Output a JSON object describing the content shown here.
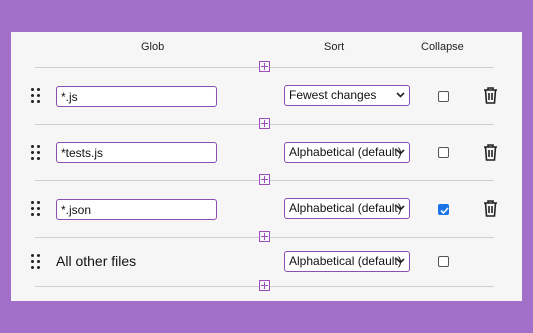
{
  "headers": {
    "glob": "Glob",
    "sort": "Sort",
    "collapse": "Collapse"
  },
  "rows": [
    {
      "glob": "*.js",
      "sort": "Fewest changes",
      "collapse": false
    },
    {
      "glob": "*tests.js",
      "sort": "Alphabetical (default)",
      "collapse": false
    },
    {
      "glob": "*.json",
      "sort": "Alphabetical (default)",
      "collapse": true
    }
  ],
  "other_row": {
    "label": "All other files",
    "sort": "Alphabetical (default)",
    "collapse": false
  },
  "icons": {
    "add": "plus-box-icon",
    "drag": "drag-handle-icon",
    "delete": "trash-icon",
    "dropdown": "chevron-down-icon",
    "check": "checkmark-icon"
  },
  "colors": {
    "background": "#a26fc9",
    "panel": "#f5f6f5",
    "accent": "#8a4fb4",
    "checkbox_checked": "#1a73e8"
  }
}
